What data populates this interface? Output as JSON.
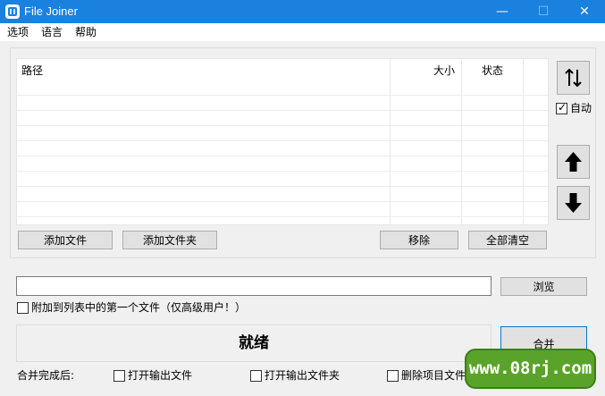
{
  "window": {
    "title": "File Joiner",
    "minimize": "—",
    "maximize": "☐",
    "close": "✕"
  },
  "menu": {
    "options": "选项",
    "language": "语言",
    "help": "帮助"
  },
  "list": {
    "col_path": "路径",
    "col_size": "大小",
    "col_status": "状态"
  },
  "side": {
    "auto_label": "自动",
    "auto_checked": true
  },
  "buttons": {
    "add_file": "添加文件",
    "add_folder": "添加文件夹",
    "remove": "移除",
    "clear_all": "全部清空",
    "browse": "浏览",
    "merge": "合并"
  },
  "output": {
    "path_value": "",
    "append_label": "附加到列表中的第一个文件（仅高级用户！）"
  },
  "status": {
    "text": "就绪"
  },
  "after": {
    "label": "合并完成后:",
    "open_file": "打开输出文件",
    "open_folder": "打开输出文件夹",
    "delete_items": "删除项目文件"
  },
  "watermark": {
    "text": "www.08rj.com"
  },
  "colors": {
    "titlebar": "#1b81df",
    "watermark": "#5aa32a"
  }
}
